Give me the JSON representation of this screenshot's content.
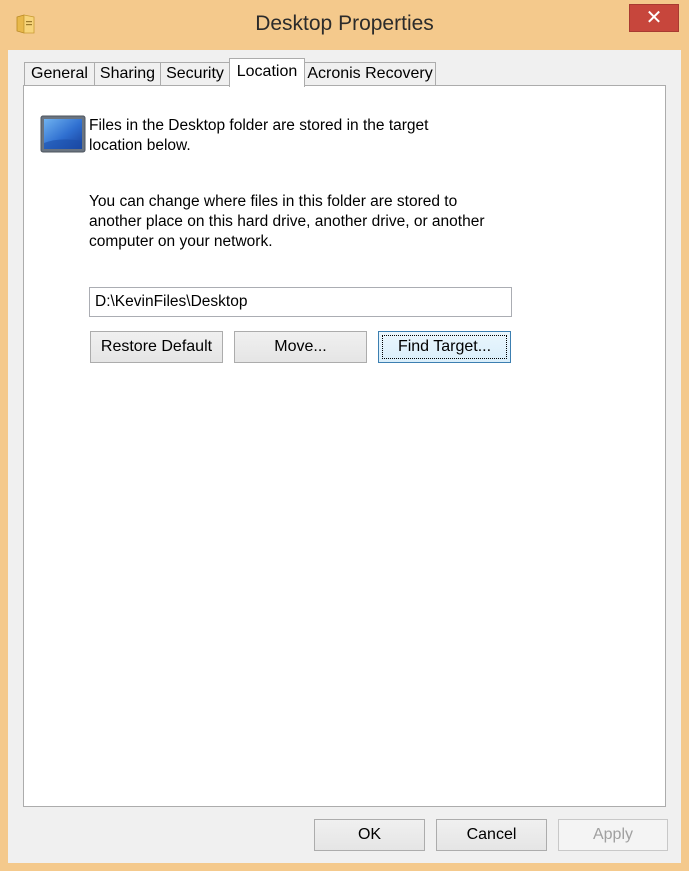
{
  "window": {
    "title": "Desktop Properties",
    "close_glyph": "✕",
    "icon": "folder-properties-icon"
  },
  "tabs": [
    {
      "label": "General",
      "active": false
    },
    {
      "label": "Sharing",
      "active": false
    },
    {
      "label": "Security",
      "active": false
    },
    {
      "label": "Location",
      "active": true
    },
    {
      "label": "Acronis Recovery",
      "active": false
    }
  ],
  "location": {
    "icon": "desktop-folder-icon",
    "description": "Files in the Desktop folder are stored in the target location below.",
    "explanation": "You can change where files in this folder are stored to another place on this hard drive, another drive, or another computer on your network.",
    "path_value": "D:\\KevinFiles\\Desktop",
    "restore_default_label": "Restore Default",
    "move_label": "Move...",
    "find_target_label": "Find Target..."
  },
  "footer": {
    "ok_label": "OK",
    "cancel_label": "Cancel",
    "apply_label": "Apply"
  },
  "colors": {
    "title_bar": "#f4c98c",
    "close_button": "#c7463c",
    "panel": "#ffffff",
    "focus_border": "#3c7fb1"
  }
}
